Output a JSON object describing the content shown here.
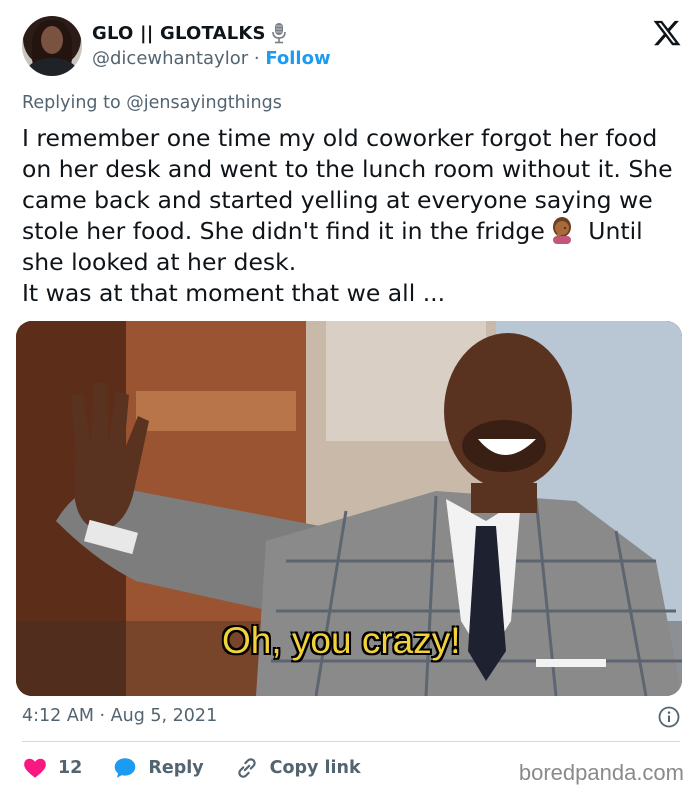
{
  "author": {
    "display_name": "GLO || GLOTALKS",
    "badge_icon": "microphone-icon",
    "handle": "@dicewhantaylor",
    "separator": "·",
    "follow_label": "Follow"
  },
  "platform_icon": "x-logo-icon",
  "reply_context": {
    "prefix": "Replying to",
    "mention": "@jensayingthings"
  },
  "tweet": {
    "text_before_emoji": "I remember one time my old coworker forgot her food on her desk and went to the lunch room without it. She came back and started yelling at everyone saying we stole her food. She didn't find it in the fridge",
    "emoji": "woman-facepalming-emoji",
    "text_after_emoji": " Until she looked at her desk.\nIt was at that moment that we all ..."
  },
  "media": {
    "caption": "Oh, you crazy!",
    "description_icon": "meme-image"
  },
  "meta": {
    "time": "4:12 AM",
    "separator": "·",
    "date": "Aug 5, 2021",
    "info_icon": "info-icon"
  },
  "actions": {
    "like_count": "12",
    "reply_label": "Reply",
    "copy_link_label": "Copy link"
  },
  "watermark": "boredpanda.com",
  "colors": {
    "accent": "#1d9bf0",
    "like": "#f91880",
    "text": "#0f1419",
    "muted": "#536471"
  }
}
